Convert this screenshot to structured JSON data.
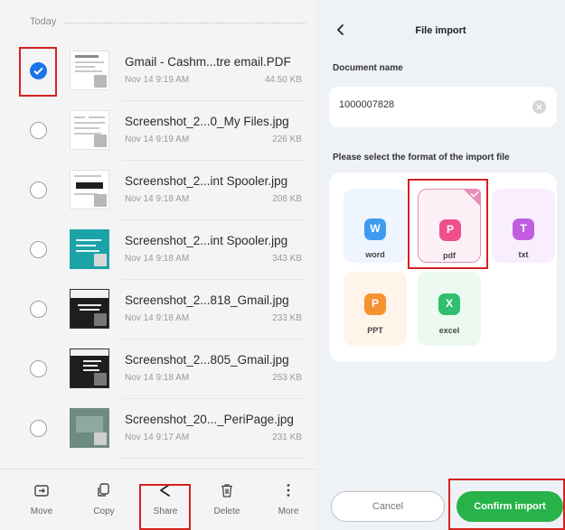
{
  "section": {
    "label": "Today"
  },
  "files": [
    {
      "name": "Gmail - Cashm...tre email.PDF",
      "date": "Nov 14 9:19 AM",
      "size": "44.50 KB",
      "selected": true
    },
    {
      "name": "Screenshot_2...0_My Files.jpg",
      "date": "Nov 14 9:19 AM",
      "size": "226 KB",
      "selected": false
    },
    {
      "name": "Screenshot_2...int Spooler.jpg",
      "date": "Nov 14 9:18 AM",
      "size": "208 KB",
      "selected": false
    },
    {
      "name": "Screenshot_2...int Spooler.jpg",
      "date": "Nov 14 9:18 AM",
      "size": "343 KB",
      "selected": false
    },
    {
      "name": "Screenshot_2...818_Gmail.jpg",
      "date": "Nov 14 9:18 AM",
      "size": "233 KB",
      "selected": false
    },
    {
      "name": "Screenshot_2...805_Gmail.jpg",
      "date": "Nov 14 9:18 AM",
      "size": "253 KB",
      "selected": false
    },
    {
      "name": "Screenshot_20..._PeriPage.jpg",
      "date": "Nov 14 9:17 AM",
      "size": "231 KB",
      "selected": false
    }
  ],
  "bottom_bar": {
    "move": "Move",
    "copy": "Copy",
    "share": "Share",
    "delete": "Delete",
    "more": "More"
  },
  "import_panel": {
    "title": "File import",
    "document_name_label": "Document name",
    "document_name_value": "1000007828",
    "format_label": "Please select the format of the import file",
    "formats": [
      {
        "label": "word",
        "glyph": "W",
        "color": "#3d9cf0",
        "selected": false
      },
      {
        "label": "pdf",
        "glyph": "P",
        "color": "#ef4f8d",
        "selected": true
      },
      {
        "label": "txt",
        "glyph": "T",
        "color": "#c15ee0",
        "selected": false
      },
      {
        "label": "PPT",
        "glyph": "P",
        "color": "#f5912e",
        "selected": false
      },
      {
        "label": "excel",
        "glyph": "X",
        "color": "#2fbf6e",
        "selected": false
      }
    ],
    "cancel_label": "Cancel",
    "confirm_label": "Confirm import"
  },
  "colors": {
    "accent_blue": "#1a73e8",
    "confirm_green": "#27b34a",
    "highlight_red": "#d42121"
  }
}
